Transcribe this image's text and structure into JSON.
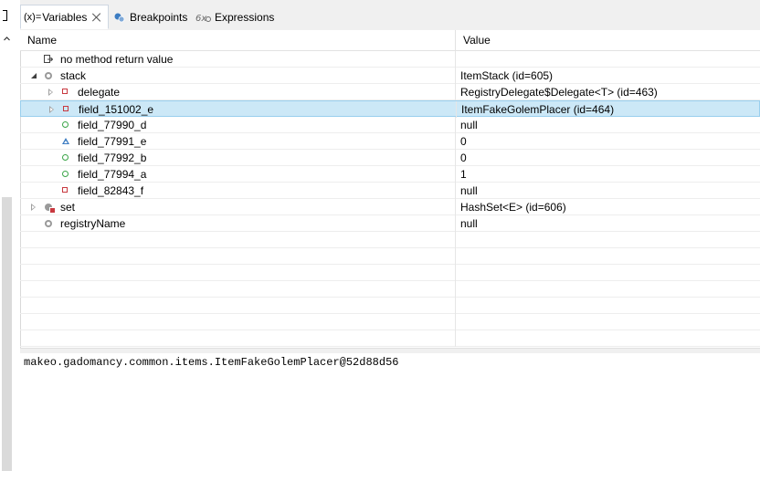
{
  "tabs": [
    {
      "prefix": "(x)=",
      "label": "Variables",
      "active": true
    },
    {
      "label": "Breakpoints",
      "active": false
    },
    {
      "label": "Expressions",
      "active": false
    }
  ],
  "table": {
    "columns": {
      "name": "Name",
      "value": "Value"
    },
    "rows": [
      {
        "name": "no method return value",
        "value": "",
        "icon": "return-icon",
        "indent": 0,
        "expander": "none"
      },
      {
        "name": "stack",
        "value": "ItemStack  (id=605)",
        "icon": "static-field-icon",
        "indent": 0,
        "expander": "open"
      },
      {
        "name": "delegate",
        "value": "RegistryDelegate$Delegate<T>  (id=463)",
        "icon": "private-field-icon",
        "indent": 1,
        "expander": "closed"
      },
      {
        "name": "field_151002_e",
        "value": "ItemFakeGolemPlacer  (id=464)",
        "icon": "private-field-icon",
        "indent": 1,
        "expander": "closed",
        "selected": true
      },
      {
        "name": "field_77990_d",
        "value": "null",
        "icon": "public-field-icon",
        "indent": 1,
        "expander": "none"
      },
      {
        "name": "field_77991_e",
        "value": "0",
        "icon": "protected-field-icon",
        "indent": 1,
        "expander": "none"
      },
      {
        "name": "field_77992_b",
        "value": "0",
        "icon": "public-field-icon",
        "indent": 1,
        "expander": "none"
      },
      {
        "name": "field_77994_a",
        "value": "1",
        "icon": "public-field-icon",
        "indent": 1,
        "expander": "none"
      },
      {
        "name": "field_82843_f",
        "value": "null",
        "icon": "private-field-icon",
        "indent": 1,
        "expander": "none"
      },
      {
        "name": "set",
        "value": "HashSet<E>  (id=606)",
        "icon": "static-private-field-icon",
        "indent": 0,
        "expander": "closed"
      },
      {
        "name": "registryName",
        "value": "null",
        "icon": "static-field-icon",
        "indent": 0,
        "expander": "none"
      }
    ]
  },
  "detail": {
    "text": "makeo.gadomancy.common.items.ItemFakeGolemPlacer@52d88d56"
  },
  "colors": {
    "selection": "#cce8f7",
    "selection_border": "#99cfee",
    "tab_bg": "#f0f0f0"
  }
}
